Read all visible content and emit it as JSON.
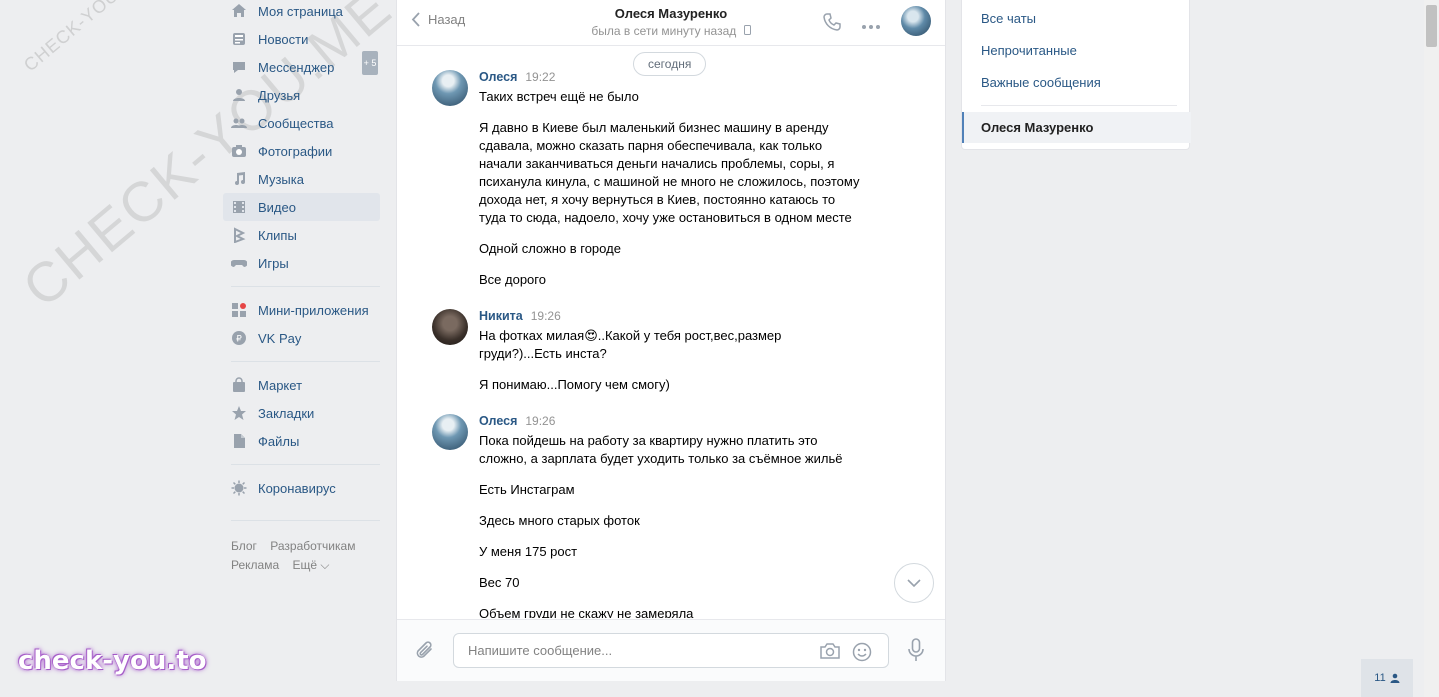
{
  "nav": {
    "items": [
      {
        "label": "Моя страница",
        "icon": "home-icon"
      },
      {
        "label": "Новости",
        "icon": "news-icon"
      },
      {
        "label": "Мессенджер",
        "icon": "messenger-icon"
      },
      {
        "label": "Друзья",
        "icon": "friends-icon"
      },
      {
        "label": "Сообщества",
        "icon": "communities-icon"
      },
      {
        "label": "Фотографии",
        "icon": "photos-icon"
      },
      {
        "label": "Музыка",
        "icon": "music-icon"
      },
      {
        "label": "Видео",
        "icon": "video-icon",
        "active": true
      },
      {
        "label": "Клипы",
        "icon": "clips-icon"
      },
      {
        "label": "Игры",
        "icon": "games-icon"
      },
      {
        "label": "Мини-приложения",
        "icon": "apps-icon"
      },
      {
        "label": "VK Pay",
        "icon": "vkpay-icon"
      },
      {
        "label": "Маркет",
        "icon": "market-icon"
      },
      {
        "label": "Закладки",
        "icon": "bookmarks-icon"
      },
      {
        "label": "Файлы",
        "icon": "files-icon"
      },
      {
        "label": "Коронавирус",
        "icon": "coronavirus-icon"
      }
    ],
    "messenger_badge": "+ 5",
    "footer": [
      "Блог",
      "Разработчикам",
      "Реклама",
      "Ещё ⌵"
    ]
  },
  "chat": {
    "back_label": "Назад",
    "peer_name": "Олеся Мазуренко",
    "peer_status": "была в сети минуту назад",
    "date_pill": "сегодня",
    "groups": [
      {
        "author": "Олеся",
        "time": "19:22",
        "avatar": "olesya",
        "messages": [
          "Таких встреч ещё не было",
          "Я давно в Киеве был маленький бизнес машину в аренду\nсдавала, можно сказать парня обеспечивала, как только\nначали заканчиваться деньги начались проблемы, соры, я\nпсиханула кинула, с машиной не много не сложилось, поэтому\nдохода нет, я хочу вернуться в Киев, постоянно катаюсь то\nтуда то сюда, надоело, хочу уже остановиться в одном месте",
          "Одной сложно в городе",
          "Все дорого"
        ]
      },
      {
        "author": "Никита",
        "time": "19:26",
        "avatar": "nikita",
        "messages": [
          "На фотках милая😍..Какой у тебя рост,вес,размер\nгруди?)...Есть инста?",
          "Я понимаю...Помогу чем смогу)"
        ]
      },
      {
        "author": "Олеся",
        "time": "19:26",
        "avatar": "olesya",
        "messages": [
          "Пока пойдешь на работу за квартиру нужно платить это\nсложно, а зарплата будет уходить только за съёмное жильё",
          "Есть Инстаграм",
          "Здесь много старых фоток",
          "У меня 175 рост",
          "Вес 70",
          "Объем груди не скажу не замеряла"
        ]
      }
    ],
    "composer_placeholder": "Напишите сообщение..."
  },
  "right_panel": {
    "items": [
      "Все чаты",
      "Непрочитанные",
      "Важные сообщения"
    ],
    "active_chat": "Олеся Мазуренко"
  },
  "counter": "11",
  "watermarks": {
    "small": "CHECK-YOU.ME",
    "large": "CHECK-YOU.ME",
    "brand": "check-you.to"
  }
}
